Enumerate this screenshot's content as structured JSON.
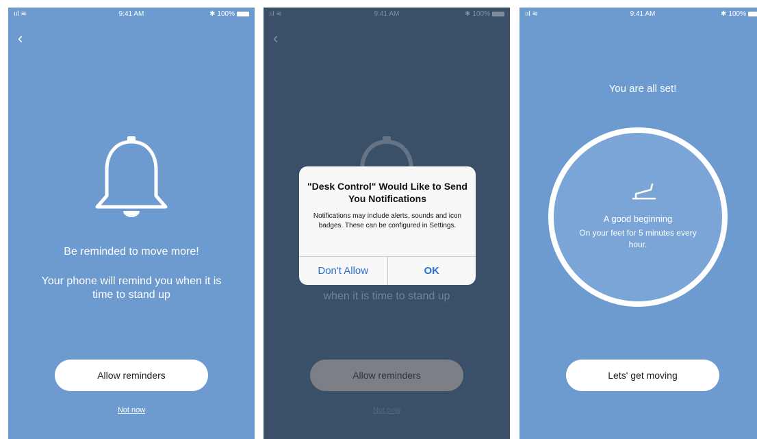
{
  "status": {
    "time": "9:41 AM",
    "battery": "100%",
    "signal": "ııl",
    "wifi": "wifi-icon"
  },
  "screen1": {
    "title": "Be reminded to move more!",
    "subtitle": "Your phone will remind you when it is time to stand up",
    "allow_button": "Allow reminders",
    "not_now": "Not now"
  },
  "screen2": {
    "dialog_title": "\"Desk Control\" Would Like to Send You Notifications",
    "dialog_message": "Notifications may include alerts, sounds and icon badges. These can be configured in Settings.",
    "dont_allow": "Don't Allow",
    "ok": "OK",
    "background_text": "when it is time to stand up",
    "allow_button": "Allow reminders",
    "not_now": "Not now"
  },
  "screen3": {
    "title": "You are all set!",
    "ring_title": "A good beginning",
    "ring_subtitle": "On your feet for 5 minutes every hour.",
    "cta": "Lets' get moving"
  },
  "colors": {
    "primary_bg": "#6d9acf",
    "dim_bg": "#3a5069",
    "link_blue": "#2a6fcf"
  }
}
